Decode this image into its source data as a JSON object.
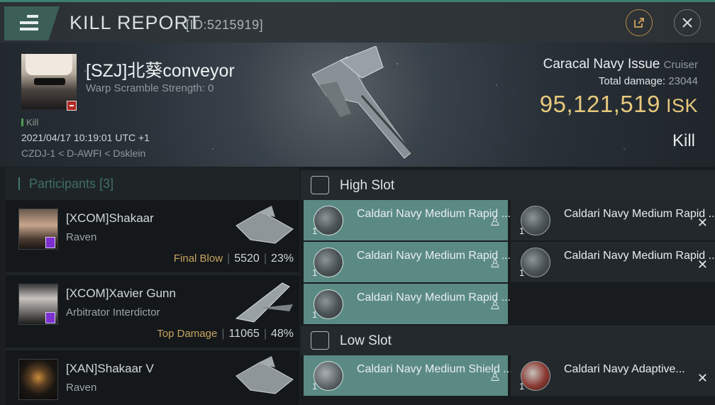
{
  "header": {
    "title": "KILL REPORT",
    "report_id": "[ID:5215919]",
    "share_icon": "share-icon",
    "close_icon": "close-icon",
    "accent": "#3e7f73"
  },
  "victim": {
    "name": "[SZJ]北葵conveyor",
    "warp_scramble": "Warp Scramble Strength: 0",
    "kill_tag": "Kill",
    "datetime": "2021/04/17 10:19:01 UTC +1",
    "location": "CZDJ-1 < D-AWFI < Dsklein",
    "ship": "Caracal Navy Issue",
    "ship_class": "Cruiser",
    "total_damage_label": "Total damage:",
    "total_damage": "23044",
    "isk_value": "95,121,519",
    "isk_unit": "ISK",
    "kill_type": "Kill"
  },
  "participants": {
    "label": "Participants",
    "count": "[3]",
    "items": [
      {
        "name": "[XCOM]Shakaar",
        "ship": "Raven",
        "tag": "Final Blow",
        "damage": "5520",
        "percent": "23%"
      },
      {
        "name": "[XCOM]Xavier Gunn",
        "ship": "Arbitrator Interdictor",
        "tag": "Top Damage",
        "damage": "11065",
        "percent": "48%"
      },
      {
        "name": "[XAN]Shakaar V",
        "ship": "Raven",
        "tag": "",
        "damage": "",
        "percent": ""
      }
    ]
  },
  "slots": {
    "high": {
      "label": "High Slot",
      "modules": [
        {
          "name": "Caldari Navy Medium Rapid ...",
          "qty": "1",
          "state": "fitted"
        },
        {
          "name": "Caldari Navy Medium Rapid ...",
          "qty": "1",
          "state": "dropped"
        },
        {
          "name": "Caldari Navy Medium Rapid ...",
          "qty": "1",
          "state": "fitted"
        },
        {
          "name": "Caldari Navy Medium Rapid ...",
          "qty": "1",
          "state": "dropped"
        },
        {
          "name": "Caldari Navy Medium Rapid ...",
          "qty": "1",
          "state": "fitted"
        }
      ]
    },
    "low": {
      "label": "Low Slot",
      "modules": [
        {
          "name": "Caldari Navy Medium Shield ...",
          "qty": "1",
          "state": "fitted"
        },
        {
          "name": "Caldari Navy Adaptive...",
          "qty": "1",
          "state": "dropped"
        }
      ]
    }
  },
  "colors": {
    "isk": "#e8c87c",
    "fitted": "#5b8a84",
    "tag": "#c6a461"
  }
}
